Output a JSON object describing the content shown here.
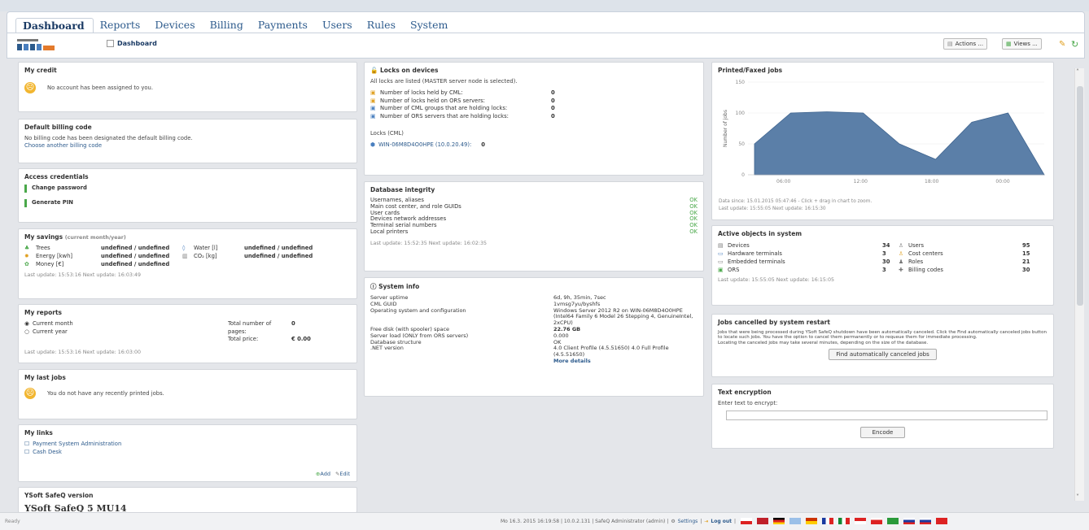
{
  "nav": {
    "tabs": [
      "Dashboard",
      "Reports",
      "Devices",
      "Billing",
      "Payments",
      "Users",
      "Rules",
      "System"
    ]
  },
  "breadcrumb": "Dashboard",
  "toolbar": {
    "actions": "Actions ...",
    "views": "Views ..."
  },
  "credit": {
    "title": "My credit",
    "text": "No account has been assigned to you."
  },
  "billing": {
    "title": "Default billing code",
    "text": "No billing code has been designated the default billing code.",
    "link": "Choose another billing code"
  },
  "access": {
    "title": "Access credentials",
    "items": [
      "Change password",
      "Generate PIN"
    ]
  },
  "savings": {
    "title": "My savings",
    "subtitle": "(current month/year)",
    "rows": [
      {
        "label": "Trees",
        "value": "undefined / undefined",
        "label2": "Water [l]",
        "value2": "undefined / undefined"
      },
      {
        "label": "Energy [kwh]",
        "value": "undefined / undefined",
        "label2": "CO₂ [kg]",
        "value2": "undefined / undefined"
      },
      {
        "label": "Money [€]",
        "value": "undefined / undefined",
        "label2": "",
        "value2": ""
      }
    ],
    "footer": "Last update: 15:53:16  Next update: 16:03:49"
  },
  "reports": {
    "title": "My reports",
    "opt1": "Current month",
    "opt2": "Current year",
    "pages_label": "Total number of pages:",
    "pages_value": "0",
    "price_label": "Total price:",
    "price_value": "€ 0.00",
    "footer": "Last update: 15:53:16  Next update: 16:03:00"
  },
  "lastjobs": {
    "title": "My last jobs",
    "text": "You do not have any recently printed jobs."
  },
  "links": {
    "title": "My links",
    "items": [
      "Payment System Administration",
      "Cash Desk"
    ],
    "add": "Add",
    "edit": "Edit"
  },
  "version": {
    "title": "YSoft SafeQ version",
    "value": "YSoft SafeQ 5 MU14"
  },
  "locks": {
    "title": "Locks on devices",
    "intro": "All locks are listed (MASTER server node is selected).",
    "rows": [
      {
        "label": "Number of locks held by CML:",
        "value": "0"
      },
      {
        "label": "Number of locks held on ORS servers:",
        "value": "0"
      },
      {
        "label": "Number of CML groups that are holding locks:",
        "value": "0"
      },
      {
        "label": "Number of ORS servers that are holding locks:",
        "value": "0"
      }
    ],
    "section": "Locks (CML)",
    "server": "WIN-06M8D4O0HPE (10.0.20.49):",
    "server_value": "0"
  },
  "dbint": {
    "title": "Database integrity",
    "rows": [
      "Usernames, aliases",
      "Main cost center, and role GUIDs",
      "User cards",
      "Devices network addresses",
      "Terminal serial numbers",
      "Local printers"
    ],
    "ok": "OK",
    "footer": "Last update: 15:52:35  Next update: 16:02:35"
  },
  "sysinfo": {
    "title": "System info",
    "rows": [
      {
        "label": "Server uptime",
        "value": "6d, 9h, 35min, 7sec"
      },
      {
        "label": "CML GUID",
        "value": "1vmsg7yu/byshfs"
      },
      {
        "label": "Operating system and configuration",
        "value": "Windows Server 2012 R2 on WIN-06M8D4O0HPE (Intel64 Family 6 Model 26 Stepping 4, GenuineIntel, 2xCPU)"
      },
      {
        "label": "Free disk (with spooler) space",
        "value": "22.76 GB"
      },
      {
        "label": "Server load (ONLY from ORS servers)",
        "value": "0.000"
      },
      {
        "label": "Database structure",
        "value": "OK"
      },
      {
        "label": ".NET version",
        "value": "4.0 Client Profile (4.5.51650) 4.0 Full Profile (4.5.51650)"
      }
    ],
    "more": "More details"
  },
  "printed": {
    "title": "Printed/Faxed jobs",
    "ylabel": "Number of jobs",
    "footer1": "Data since: 15.01.2015 05:47:46 - Click + drag in chart to zoom.",
    "footer2": "Last update: 15:55:05  Next update: 16:15:30"
  },
  "chart_data": {
    "type": "area",
    "x": [
      "06:00",
      "12:00",
      "18:00",
      "00:00",
      "06:00",
      "12:00",
      "18:00"
    ],
    "xticks": [
      "06:00",
      "12:00",
      "18:00",
      "00:00"
    ],
    "values": [
      50,
      100,
      102,
      100,
      50,
      25,
      85,
      100,
      0
    ],
    "ylim": [
      0,
      150
    ],
    "yticks": [
      0,
      50,
      100,
      150
    ],
    "color": "#5b7fa8"
  },
  "active": {
    "title": "Active objects in system",
    "left": [
      {
        "label": "Devices",
        "value": "34"
      },
      {
        "label": "Hardware terminals",
        "value": "3"
      },
      {
        "label": "Embedded terminals",
        "value": "30"
      },
      {
        "label": "ORS",
        "value": "3"
      }
    ],
    "right": [
      {
        "label": "Users",
        "value": "95"
      },
      {
        "label": "Cost centers",
        "value": "15"
      },
      {
        "label": "Roles",
        "value": "21"
      },
      {
        "label": "Billing codes",
        "value": "30"
      }
    ],
    "footer": "Last update: 15:55:05  Next update: 16:15:05"
  },
  "cancelled": {
    "title": "Jobs cancelled by system restart",
    "text": "Jobs that were being processed during YSoft SafeQ shutdown have been automatically canceled. Click the Find automatically canceled jobs button to locate such jobs. You have the option to cancel them permanently or to requeue them for immediate processing.",
    "text2": "Locating the canceled jobs may take several minutes, depending on the size of the database.",
    "button": "Find automatically canceled jobs"
  },
  "encrypt": {
    "title": "Text encryption",
    "label": "Enter text to encrypt:",
    "button": "Encode"
  },
  "status": {
    "text": "Mo 16.3. 2015 16:19:58 | 10.0.2.131 | SafeQ Administrator (admin) |",
    "settings": "Settings",
    "logout": "Log out",
    "left": "Ready"
  }
}
